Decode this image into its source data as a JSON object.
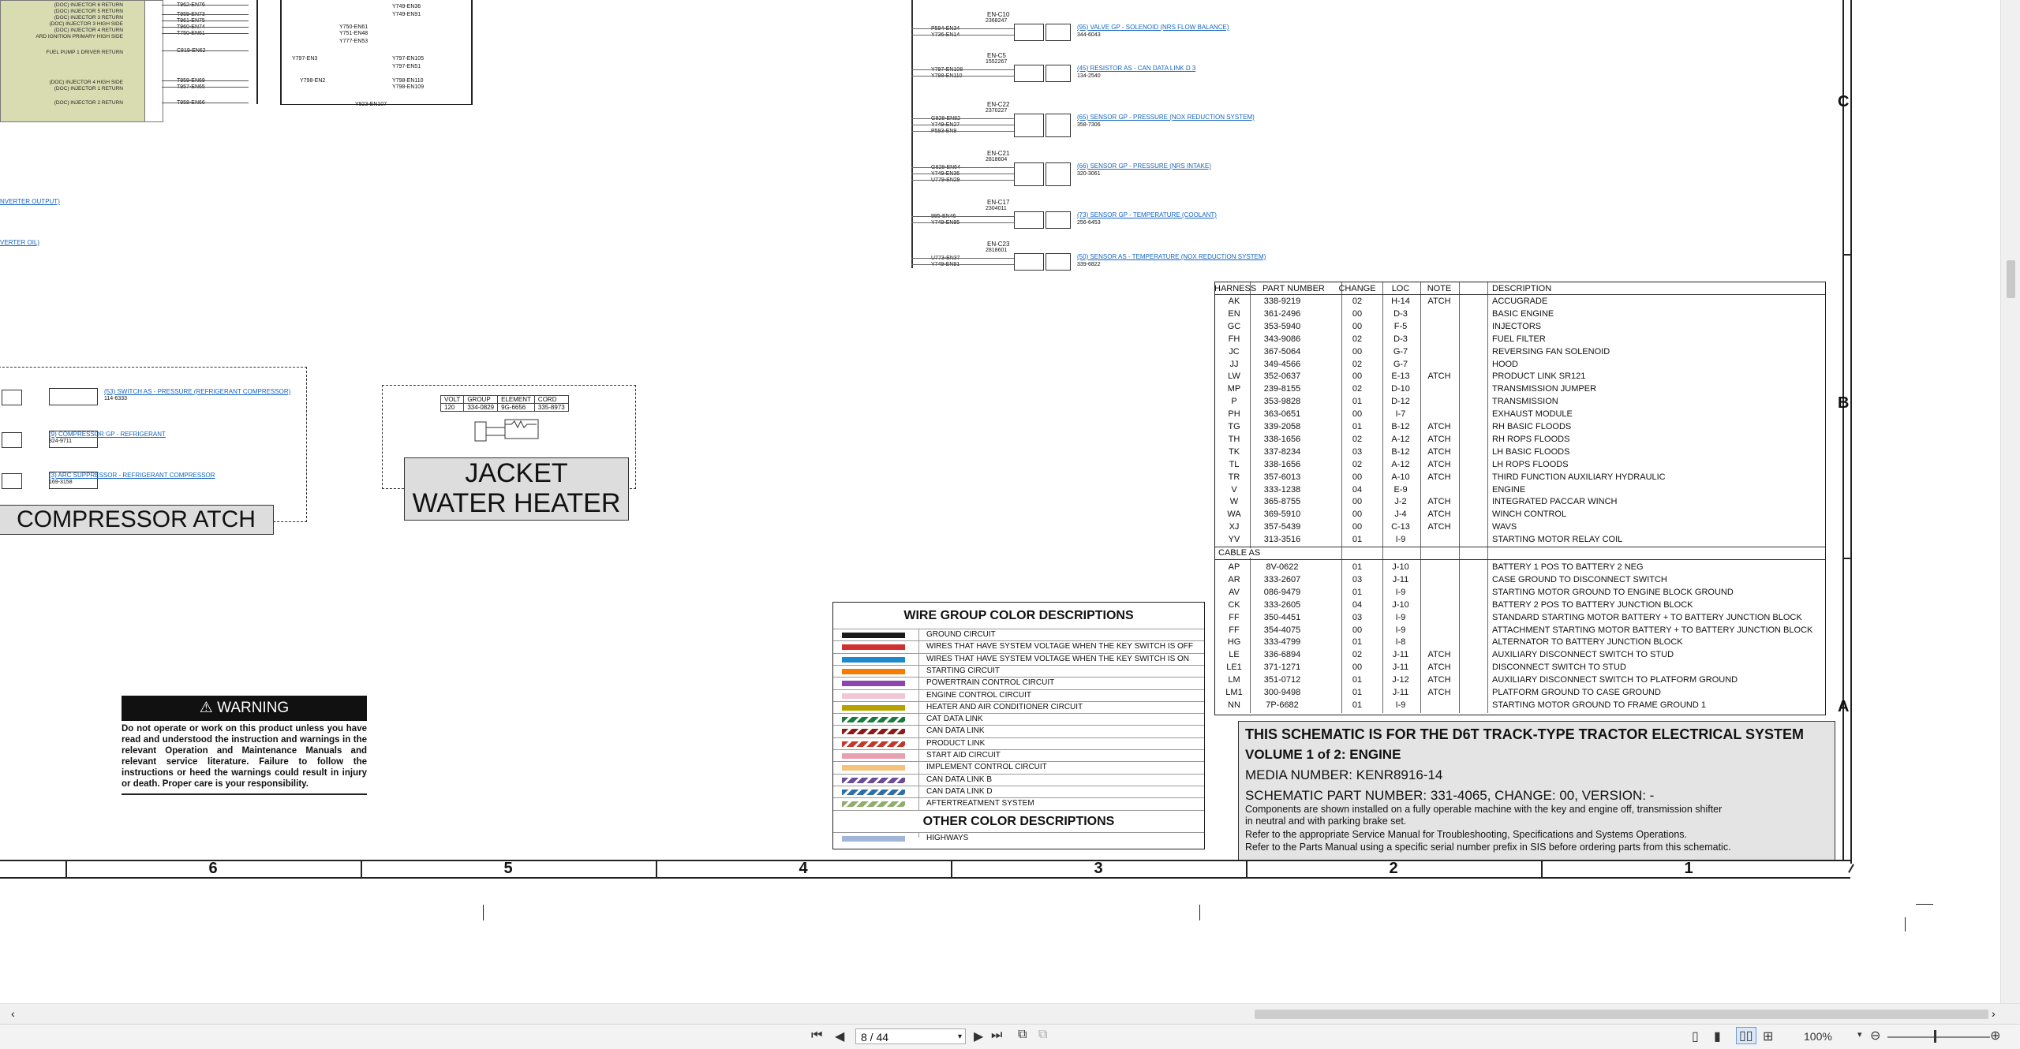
{
  "schematic": {
    "top_left_labels": [
      "(DOC) INJECTOR 6 RETURN",
      "(DOC) INJECTOR 5 RETURN",
      "(DOC) INJECTOR 3 RETURN",
      "(DOC) INJECTOR 3 HIGH SIDE",
      "(DOC) INJECTOR 4 RETURN",
      "ARD IGNITION PRIMARY HIGH SIDE",
      "FUEL PUMP 1 DRIVER RETURN",
      "(DOC) INJECTOR 4 HIGH SIDE",
      "(DOC) INJECTOR 1 RETURN",
      "(DOC) INJECTOR 2 RETURN"
    ],
    "top_left_wires": [
      "T962-EN76",
      "T959-EN73",
      "T961-EN75",
      "T960-EN74",
      "T750-EN61",
      "C819-EN62",
      "T959-EN69",
      "T957-EN65",
      "T958-EN66"
    ],
    "mid_wires": [
      "Y750-EN61",
      "Y751-EN48",
      "Y777-EN53",
      "Y797-EN3",
      "Y797-EN105",
      "Y797-EN51",
      "Y798-EN2",
      "Y798-EN110",
      "Y798-EN109",
      "Y923-EN107",
      "Y749-EN36",
      "Y749-EN91"
    ],
    "left_edge_links": [
      "NVERTER OUTPUT)",
      "VERTER OIL)"
    ],
    "connectors": [
      {
        "id": "EN-C10",
        "num": "2368247",
        "wires": [
          "P594-EN34",
          "Y736-EN14"
        ],
        "link": "(95) VALVE GP - SOLENOID (NRS FLOW BALANCE)",
        "part": "344-6043"
      },
      {
        "id": "EN-C5",
        "num": "1552267",
        "wires": [
          "Y797-EN108",
          "Y798-EN110"
        ],
        "link": "(45) RESISTOR AS - CAN DATA LINK D 3",
        "part": "134-2540"
      },
      {
        "id": "EN-C22",
        "num": "2370227",
        "wires": [
          "G828-EN82",
          "Y749-EN27",
          "P593-EN9"
        ],
        "link": "(65) SENSOR GP - PRESSURE (NOX REDUCTION SYSTEM)",
        "part": "358-7306"
      },
      {
        "id": "EN-C21",
        "num": "2818604",
        "wires": [
          "G828-EN64",
          "Y749-EN36",
          "U779-EN29"
        ],
        "link": "(66) SENSOR GP - PRESSURE (NRS INTAKE)",
        "part": "320-3061"
      },
      {
        "id": "EN-C17",
        "num": "2304011",
        "wires": [
          "995-EN46",
          "Y749-EN95"
        ],
        "link": "(73) SENSOR GP - TEMPERATURE (COOLANT)",
        "part": "256-6453"
      },
      {
        "id": "EN-C23",
        "num": "2818601",
        "wires": [
          "U773-EN37",
          "Y749-EN91"
        ],
        "link": "(50) SENSOR AS - TEMPERATURE (NOX REDUCTION SYSTEM)",
        "part": "339-6822"
      }
    ],
    "compressor": {
      "title": "COMPRESSOR ATCH",
      "links": [
        {
          "text": "(53) SWITCH AS - PRESSURE (REFRIGERANT COMPRESSOR)",
          "part": "114-6333"
        },
        {
          "text": "(9) COMPRESSOR GP - REFRIGERANT",
          "part": "324-9711"
        },
        {
          "text": "(3) ARC SUPPRESSOR - REFRIGERANT COMPRESSOR",
          "part": "169-3158"
        }
      ]
    },
    "heater": {
      "title_line1": "JACKET",
      "title_line2": "WATER HEATER",
      "table_headers": [
        "VOLT",
        "GROUP",
        "ELEMENT",
        "CORD"
      ],
      "table_values": [
        "120",
        "334-0829",
        "9G-6656",
        "335-8973"
      ]
    },
    "warning": {
      "title": "WARNING",
      "body": "Do not operate or work on this product unless you have read and understood the instruction and warnings in the relevant Operation and Maintenance Manuals and relevant service literature. Failure to follow the instructions or heed the warnings could result in injury or death. Proper care is your responsibility."
    },
    "wire_colors": {
      "title": "WIRE GROUP COLOR DESCRIPTIONS",
      "items": [
        {
          "label": "GROUND CIRCUIT",
          "color": "#1a1a1a"
        },
        {
          "label": "WIRES THAT HAVE SYSTEM VOLTAGE WHEN THE KEY SWITCH IS OFF",
          "color": "#d32f2f"
        },
        {
          "label": "WIRES THAT HAVE SYSTEM VOLTAGE WHEN THE KEY SWITCH IS ON",
          "color": "#1e88c8"
        },
        {
          "label": "STARTING CIRCUIT",
          "color": "#f57c00"
        },
        {
          "label": "POWERTRAIN CONTROL CIRCUIT",
          "color": "#8e44ad"
        },
        {
          "label": "ENGINE CONTROL CIRCUIT",
          "color": "#f3c6d6"
        },
        {
          "label": "HEATER AND AIR CONDITIONER CIRCUIT",
          "color": "#b5a100"
        },
        {
          "label": "CAT DATA LINK",
          "color": "#1b7a3e"
        },
        {
          "label": "CAN DATA LINK",
          "color": "#8b1a1a"
        },
        {
          "label": "PRODUCT LINK",
          "color": "#c0392b"
        },
        {
          "label": "START AID CIRCUIT",
          "color": "#e8a0b0"
        },
        {
          "label": "IMPLEMENT CONTROL CIRCUIT",
          "color": "#f4c27a"
        },
        {
          "label": "CAN DATA LINK B",
          "color": "#6b4c9a"
        },
        {
          "label": "CAN DATA LINK D",
          "color": "#2e6fa8"
        },
        {
          "label": "AFTERTREATMENT SYSTEM",
          "color": "#8fae6a"
        }
      ],
      "other_title": "OTHER COLOR DESCRIPTIONS",
      "other_items": [
        {
          "label": "HIGHWAYS",
          "color": "#9fb6d8"
        }
      ]
    },
    "harness_table": {
      "headers": [
        "HARNESS",
        "PART NUMBER",
        "CHANGE",
        "LOC",
        "NOTE",
        "DESCRIPTION"
      ],
      "rows": [
        [
          "AK",
          "338-9219",
          "02",
          "H-14",
          "ATCH",
          "ACCUGRADE"
        ],
        [
          "EN",
          "361-2496",
          "00",
          "D-3",
          "",
          "BASIC ENGINE"
        ],
        [
          "GC",
          "353-5940",
          "00",
          "F-5",
          "",
          "INJECTORS"
        ],
        [
          "FH",
          "343-9086",
          "02",
          "D-3",
          "",
          "FUEL FILTER"
        ],
        [
          "JC",
          "367-5064",
          "00",
          "G-7",
          "",
          "REVERSING FAN SOLENOID"
        ],
        [
          "JJ",
          "349-4566",
          "02",
          "G-7",
          "",
          "HOOD"
        ],
        [
          "LW",
          "352-0637",
          "00",
          "E-13",
          "ATCH",
          "PRODUCT LINK SR121"
        ],
        [
          "MP",
          "239-8155",
          "02",
          "D-10",
          "",
          "TRANSMISSION JUMPER"
        ],
        [
          "P",
          "353-9828",
          "01",
          "D-12",
          "",
          "TRANSMISSION"
        ],
        [
          "PH",
          "363-0651",
          "00",
          "I-7",
          "",
          "EXHAUST MODULE"
        ],
        [
          "TG",
          "339-2058",
          "01",
          "B-12",
          "ATCH",
          "RH BASIC FLOODS"
        ],
        [
          "TH",
          "338-1656",
          "02",
          "A-12",
          "ATCH",
          "RH ROPS FLOODS"
        ],
        [
          "TK",
          "337-8234",
          "03",
          "B-12",
          "ATCH",
          "LH BASIC FLOODS"
        ],
        [
          "TL",
          "338-1656",
          "02",
          "A-12",
          "ATCH",
          "LH ROPS FLOODS"
        ],
        [
          "TR",
          "357-6013",
          "00",
          "A-10",
          "ATCH",
          "THIRD FUNCTION AUXILIARY HYDRAULIC"
        ],
        [
          "V",
          "333-1238",
          "04",
          "E-9",
          "",
          "ENGINE"
        ],
        [
          "W",
          "365-8755",
          "00",
          "J-2",
          "ATCH",
          "INTEGRATED PACCAR WINCH"
        ],
        [
          "WA",
          "369-5910",
          "00",
          "J-4",
          "ATCH",
          "WINCH CONTROL"
        ],
        [
          "XJ",
          "357-5439",
          "00",
          "C-13",
          "ATCH",
          "WAVS"
        ],
        [
          "YV",
          "313-3516",
          "01",
          "I-9",
          "",
          "STARTING MOTOR RELAY COIL"
        ]
      ],
      "cable_header": "CABLE AS",
      "cable_rows": [
        [
          "AP",
          "8V-0622",
          "01",
          "J-10",
          "",
          "BATTERY 1 POS TO BATTERY 2 NEG"
        ],
        [
          "AR",
          "333-2607",
          "03",
          "J-11",
          "",
          "CASE GROUND TO DISCONNECT SWITCH"
        ],
        [
          "AV",
          "086-9479",
          "01",
          "I-9",
          "",
          "STARTING MOTOR GROUND TO ENGINE BLOCK GROUND"
        ],
        [
          "CK",
          "333-2605",
          "04",
          "J-10",
          "",
          "BATTERY 2 POS TO BATTERY JUNCTION BLOCK"
        ],
        [
          "FF",
          "350-4451",
          "03",
          "I-9",
          "",
          "STANDARD STARTING MOTOR BATTERY + TO BATTERY JUNCTION BLOCK"
        ],
        [
          "FF",
          "354-4075",
          "00",
          "I-9",
          "",
          "ATTACHMENT STARTING MOTOR BATTERY + TO BATTERY JUNCTION BLOCK"
        ],
        [
          "HG",
          "333-4799",
          "01",
          "I-8",
          "",
          "ALTERNATOR TO BATTERY JUNCTION BLOCK"
        ],
        [
          "LE",
          "336-6894",
          "02",
          "J-11",
          "ATCH",
          "AUXILIARY DISCONNECT SWITCH TO STUD"
        ],
        [
          "LE1",
          "371-1271",
          "00",
          "J-11",
          "ATCH",
          "DISCONNECT SWITCH TO STUD"
        ],
        [
          "LM",
          "351-0712",
          "01",
          "J-12",
          "ATCH",
          "AUXILIARY DISCONNECT SWITCH TO PLATFORM GROUND"
        ],
        [
          "LM1",
          "300-9498",
          "01",
          "J-11",
          "ATCH",
          "PLATFORM GROUND TO CASE GROUND"
        ],
        [
          "NN",
          "7P-6682",
          "01",
          "I-9",
          "",
          "STARTING MOTOR GROUND TO FRAME GROUND 1"
        ]
      ]
    },
    "title_block": {
      "line1": "THIS SCHEMATIC IS FOR THE D6T TRACK-TYPE TRACTOR ELECTRICAL SYSTEM",
      "line2": "VOLUME 1 of 2: ENGINE",
      "line3": "MEDIA NUMBER: KENR8916-14",
      "line4": "SCHEMATIC PART NUMBER: 331-4065, CHANGE: 00, VERSION: -",
      "line5": "Components are shown installed on a fully operable machine with the key and engine off, transmission shifter",
      "line6": "in neutral and with parking brake set.",
      "line7": "Refer to the appropriate Service Manual for Troubleshooting, Specifications and Systems Operations.",
      "line8": "Refer to the Parts Manual using a specific serial number prefix in SIS before ordering parts from this schematic."
    },
    "grid_columns": [
      "6",
      "5",
      "4",
      "3",
      "2",
      "1"
    ],
    "grid_rows": [
      "C",
      "B",
      "A"
    ]
  },
  "statusbar": {
    "page_value": "8 / 44",
    "zoom": "100%"
  }
}
